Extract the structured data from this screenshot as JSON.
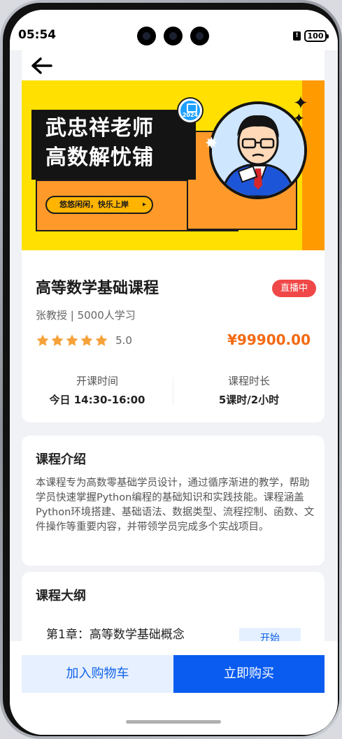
{
  "status_bar": {
    "time": "05:54",
    "battery": "100"
  },
  "banner": {
    "title_line1": "武忠祥老师",
    "title_line2": "高数解忧铺",
    "slogan": "悠悠闲闲，快乐上岸",
    "year_badge": "2024"
  },
  "course": {
    "title": "高等数学基础课程",
    "live_badge": "直播中",
    "teacher_line": "张教授 | 5000人学习",
    "rating": "5.0",
    "rating_stars": 5,
    "price": "¥99900.00",
    "start_label": "开课时间",
    "start_value": "今日 14:30-16:00",
    "duration_label": "课程时长",
    "duration_value": "5课时/2小时"
  },
  "intro": {
    "title": "课程介绍",
    "text": "本课程专为高数零基础学员设计，通过循序渐进的教学，帮助学员快速掌握Python编程的基础知识和实践技能。课程涵盖Python环境搭建、基础语法、数据类型、流程控制、函数、文件操作等重要内容，并带领学员完成多个实战项目。"
  },
  "outline": {
    "title": "课程大纲",
    "chapters": [
      {
        "label": "第1章：高等数学基础概念",
        "action": "开始"
      }
    ]
  },
  "actions": {
    "add_cart": "加入购物车",
    "buy_now": "立即购买"
  },
  "colors": {
    "accent_blue": "#0a5cf0",
    "price_orange": "#f36a12",
    "live_red": "#f04848",
    "banner_yellow": "#ffe000"
  },
  "icons": [
    "back-arrow-icon",
    "star-icon",
    "sim-icon",
    "battery-icon"
  ]
}
